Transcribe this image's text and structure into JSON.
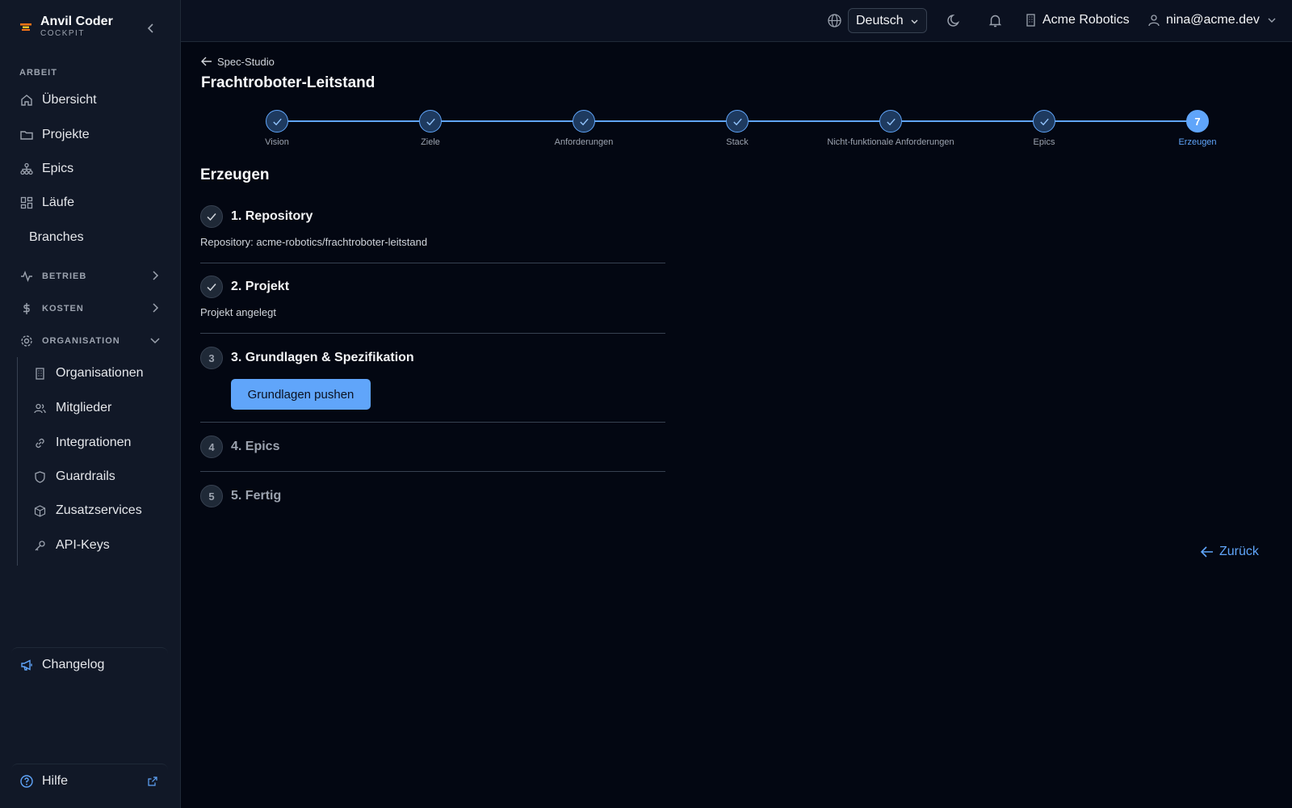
{
  "brand": {
    "name": "Anvil Coder",
    "subtitle": "COCKPIT"
  },
  "sidebar": {
    "section_work": "ARBEIT",
    "items": [
      {
        "label": "Übersicht",
        "icon": "home-icon"
      },
      {
        "label": "Projekte",
        "icon": "folder-icon"
      },
      {
        "label": "Epics",
        "icon": "hierarchy-icon"
      },
      {
        "label": "Läufe",
        "icon": "dashboard-icon"
      },
      {
        "label": "Branches",
        "icon": ""
      }
    ],
    "groups": [
      {
        "label": "BETRIEB",
        "icon": "activity-icon",
        "expanded": false
      },
      {
        "label": "KOSTEN",
        "icon": "dollar-icon",
        "expanded": false
      },
      {
        "label": "ORGANISATION",
        "icon": "gear-icon",
        "expanded": true
      }
    ],
    "org_items": [
      {
        "label": "Organisationen",
        "icon": "building-icon"
      },
      {
        "label": "Mitglieder",
        "icon": "users-icon"
      },
      {
        "label": "Integrationen",
        "icon": "link-icon"
      },
      {
        "label": "Guardrails",
        "icon": "shield-icon"
      },
      {
        "label": "Zusatzservices",
        "icon": "package-icon"
      },
      {
        "label": "API-Keys",
        "icon": "key-icon"
      }
    ],
    "changelog": "Changelog",
    "help": "Hilfe"
  },
  "topbar": {
    "language": "Deutsch",
    "organization": "Acme Robotics",
    "user": "nina@acme.dev"
  },
  "main": {
    "back_label": "Spec-Studio",
    "title": "Frachtroboter-Leitstand",
    "steps": [
      {
        "label": "Vision",
        "done": true
      },
      {
        "label": "Ziele",
        "done": true
      },
      {
        "label": "Anforderungen",
        "done": true
      },
      {
        "label": "Stack",
        "done": true
      },
      {
        "label": "Nicht-funktionale Anforderungen",
        "done": true
      },
      {
        "label": "Epics",
        "done": true
      },
      {
        "label": "Erzeugen",
        "done": false,
        "number": "7"
      }
    ],
    "section_title": "Erzeugen",
    "gen_steps": [
      {
        "number": "1",
        "title": "1. Repository",
        "desc": "Repository: acme-robotics/frachtroboter-leitstand",
        "status": "done"
      },
      {
        "number": "2",
        "title": "2. Projekt",
        "desc": "Projekt angelegt",
        "status": "done"
      },
      {
        "number": "3",
        "title": "3. Grundlagen & Spezifikation",
        "desc": "",
        "status": "active",
        "button": "Grundlagen pushen"
      },
      {
        "number": "4",
        "title": "4. Epics",
        "desc": "",
        "status": "pending"
      },
      {
        "number": "5",
        "title": "5. Fertig",
        "desc": "",
        "status": "pending"
      }
    ],
    "back_button": "Zurück"
  },
  "colors": {
    "accent": "#60a5fa",
    "background": "#030712",
    "sidebar": "#111827"
  }
}
